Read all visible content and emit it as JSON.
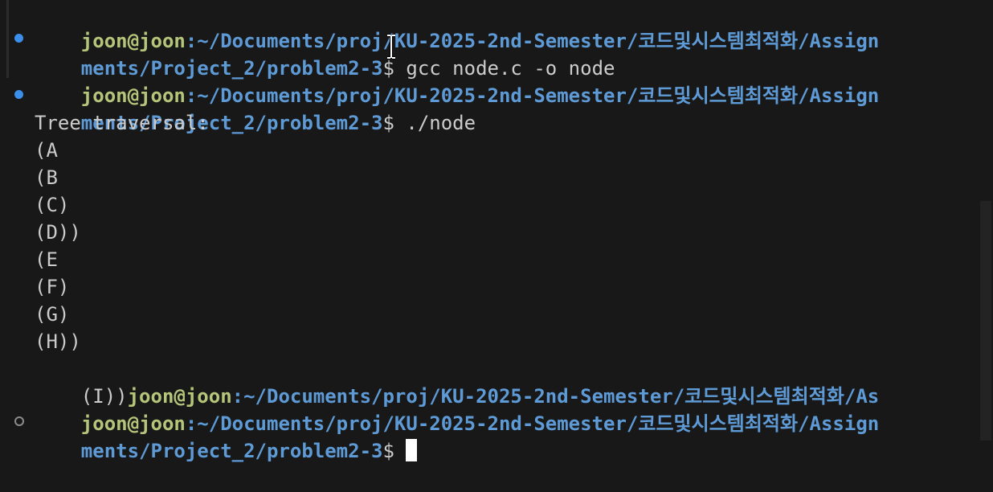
{
  "theme": {
    "background": "#181818",
    "user_color": "#b5c57a",
    "path_color": "#5e9bd6",
    "text_color": "#cccccc",
    "decoration_success": "#3b8eea"
  },
  "terminal": {
    "prompt1": {
      "user": "joon@joon",
      "path_a": ":~/Documents/proj/KU-2025-2nd-Semester/코드및시스템최적화/Assign",
      "path_b": "ments/Project_2/problem2-3",
      "symbol": "$",
      "command": " gcc node.c -o node"
    },
    "prompt2": {
      "user": "joon@joon",
      "path_a": ":~/Documents/proj/KU-2025-2nd-Semester/코드및시스템최적화/Assign",
      "path_b": "ments/Project_2/problem2-3",
      "symbol": "$",
      "command": " ./node"
    },
    "output": [
      "Tree traversal:",
      "(A",
      "(B",
      "(C)",
      "(D))",
      "(E",
      "(F)",
      "(G)",
      "(H))",
      "(I))"
    ],
    "inline_prompt": {
      "user": "joon@joon",
      "path": ":~/Documents/proj/KU-2025-2nd-Semester/코드및시스템최적화/As"
    },
    "prompt3": {
      "user": "joon@joon",
      "path_a": ":~/Documents/proj/KU-2025-2nd-Semester/코드및시스템최적화/Assign",
      "path_b": "ments/Project_2/problem2-3",
      "symbol": "$"
    }
  },
  "icons": {
    "command_success": "circle-filled-icon",
    "command_pending": "circle-hollow-icon",
    "mouse_pointer": "text-ibeam-icon"
  }
}
